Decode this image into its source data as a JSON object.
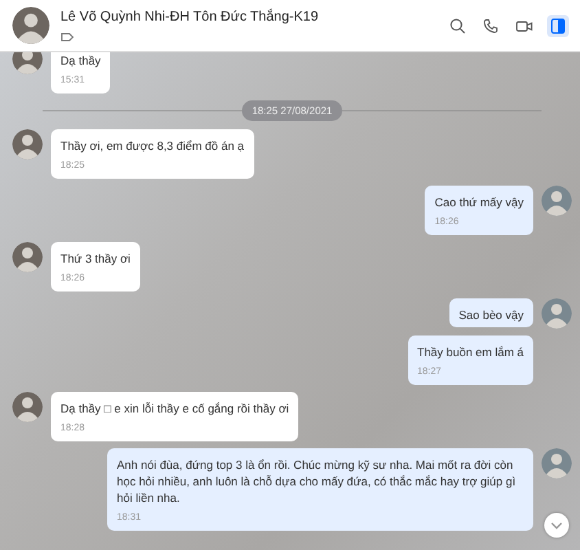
{
  "header": {
    "title": "Lê Võ Quỳnh Nhi-ĐH Tôn Đức Thắng-K19",
    "sidebar_toggle": {
      "selected": true
    }
  },
  "messages": [
    {
      "kind": "message",
      "outgoing": false,
      "show_avatar": true,
      "text": "Dạ thầy",
      "time": "15:31"
    },
    {
      "kind": "divider",
      "text": "18:25 27/08/2021"
    },
    {
      "kind": "message",
      "outgoing": false,
      "show_avatar": true,
      "text": "Thầy ơi, em được 8,3 điểm đồ án ạ",
      "time": "18:25"
    },
    {
      "kind": "message",
      "outgoing": true,
      "show_avatar": true,
      "text": "Cao thứ mấy vậy",
      "time": "18:26"
    },
    {
      "kind": "message",
      "outgoing": false,
      "show_avatar": true,
      "text": "Thứ 3 thầy ơi",
      "time": "18:26"
    },
    {
      "kind": "message",
      "outgoing": true,
      "show_avatar": true,
      "text": "Sao bèo vậy"
    },
    {
      "kind": "message",
      "outgoing": true,
      "show_avatar": false,
      "text": "Thầy buồn em lắm á",
      "time": "18:27"
    },
    {
      "kind": "message",
      "outgoing": false,
      "show_avatar": true,
      "text": "Dạ thầy □ e xin lỗi thầy e cố gắng rồi thầy ơi",
      "time": "18:28"
    },
    {
      "kind": "message",
      "outgoing": true,
      "show_avatar": true,
      "text": "Anh nói đùa, đứng top 3 là ổn rồi. Chúc mừng kỹ sư nha. Mai mốt ra đời còn học hỏi nhiều, anh luôn là chỗ dựa cho mấy đứa, có thắc mắc hay trợ giúp gì hỏi liền nha.",
      "time": "18:31"
    }
  ]
}
